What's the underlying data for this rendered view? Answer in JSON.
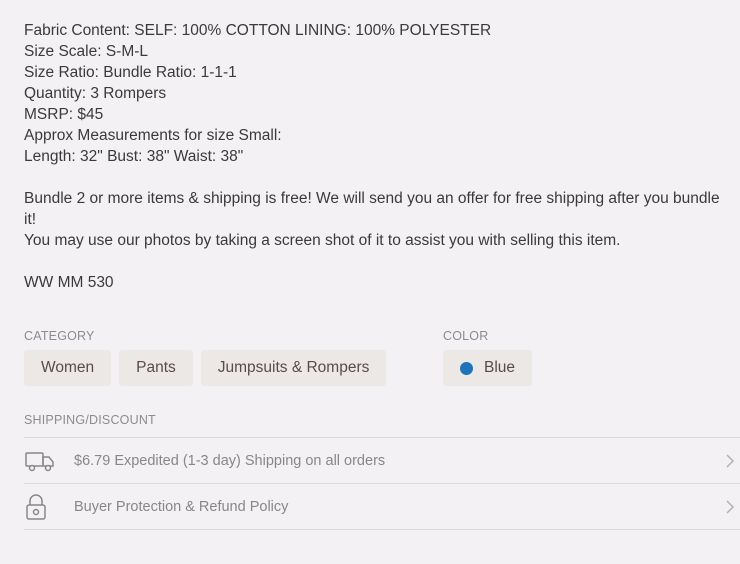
{
  "description": {
    "lines": [
      "Fabric Content: SELF: 100% COTTON LINING: 100% POLYESTER",
      "Size Scale: S-M-L",
      "Size Ratio: Bundle Ratio: 1-1-1",
      "Quantity: 3 Rompers",
      "MSRP: $45",
      "Approx Measurements for size Small:",
      "Length: 32\" Bust: 38\" Waist: 38\""
    ],
    "bundle_text": "Bundle 2 or more items & shipping is free! We will send you an offer for free shipping after you bundle it!",
    "photos_text": "You may use our photos by taking a screen shot of it to assist you with selling this item.",
    "sku": "WW MM 530"
  },
  "category": {
    "label": "CATEGORY",
    "chips": [
      "Women",
      "Pants",
      "Jumpsuits & Rompers"
    ]
  },
  "color": {
    "label": "COLOR",
    "value": "Blue",
    "swatch": "#1e73be"
  },
  "shipping": {
    "label": "SHIPPING/DISCOUNT",
    "rows": [
      {
        "icon": "truck-icon",
        "text": "$6.79 Expedited (1-3 day) Shipping on all orders"
      },
      {
        "icon": "lock-icon",
        "text": "Buyer Protection & Refund Policy"
      }
    ]
  }
}
